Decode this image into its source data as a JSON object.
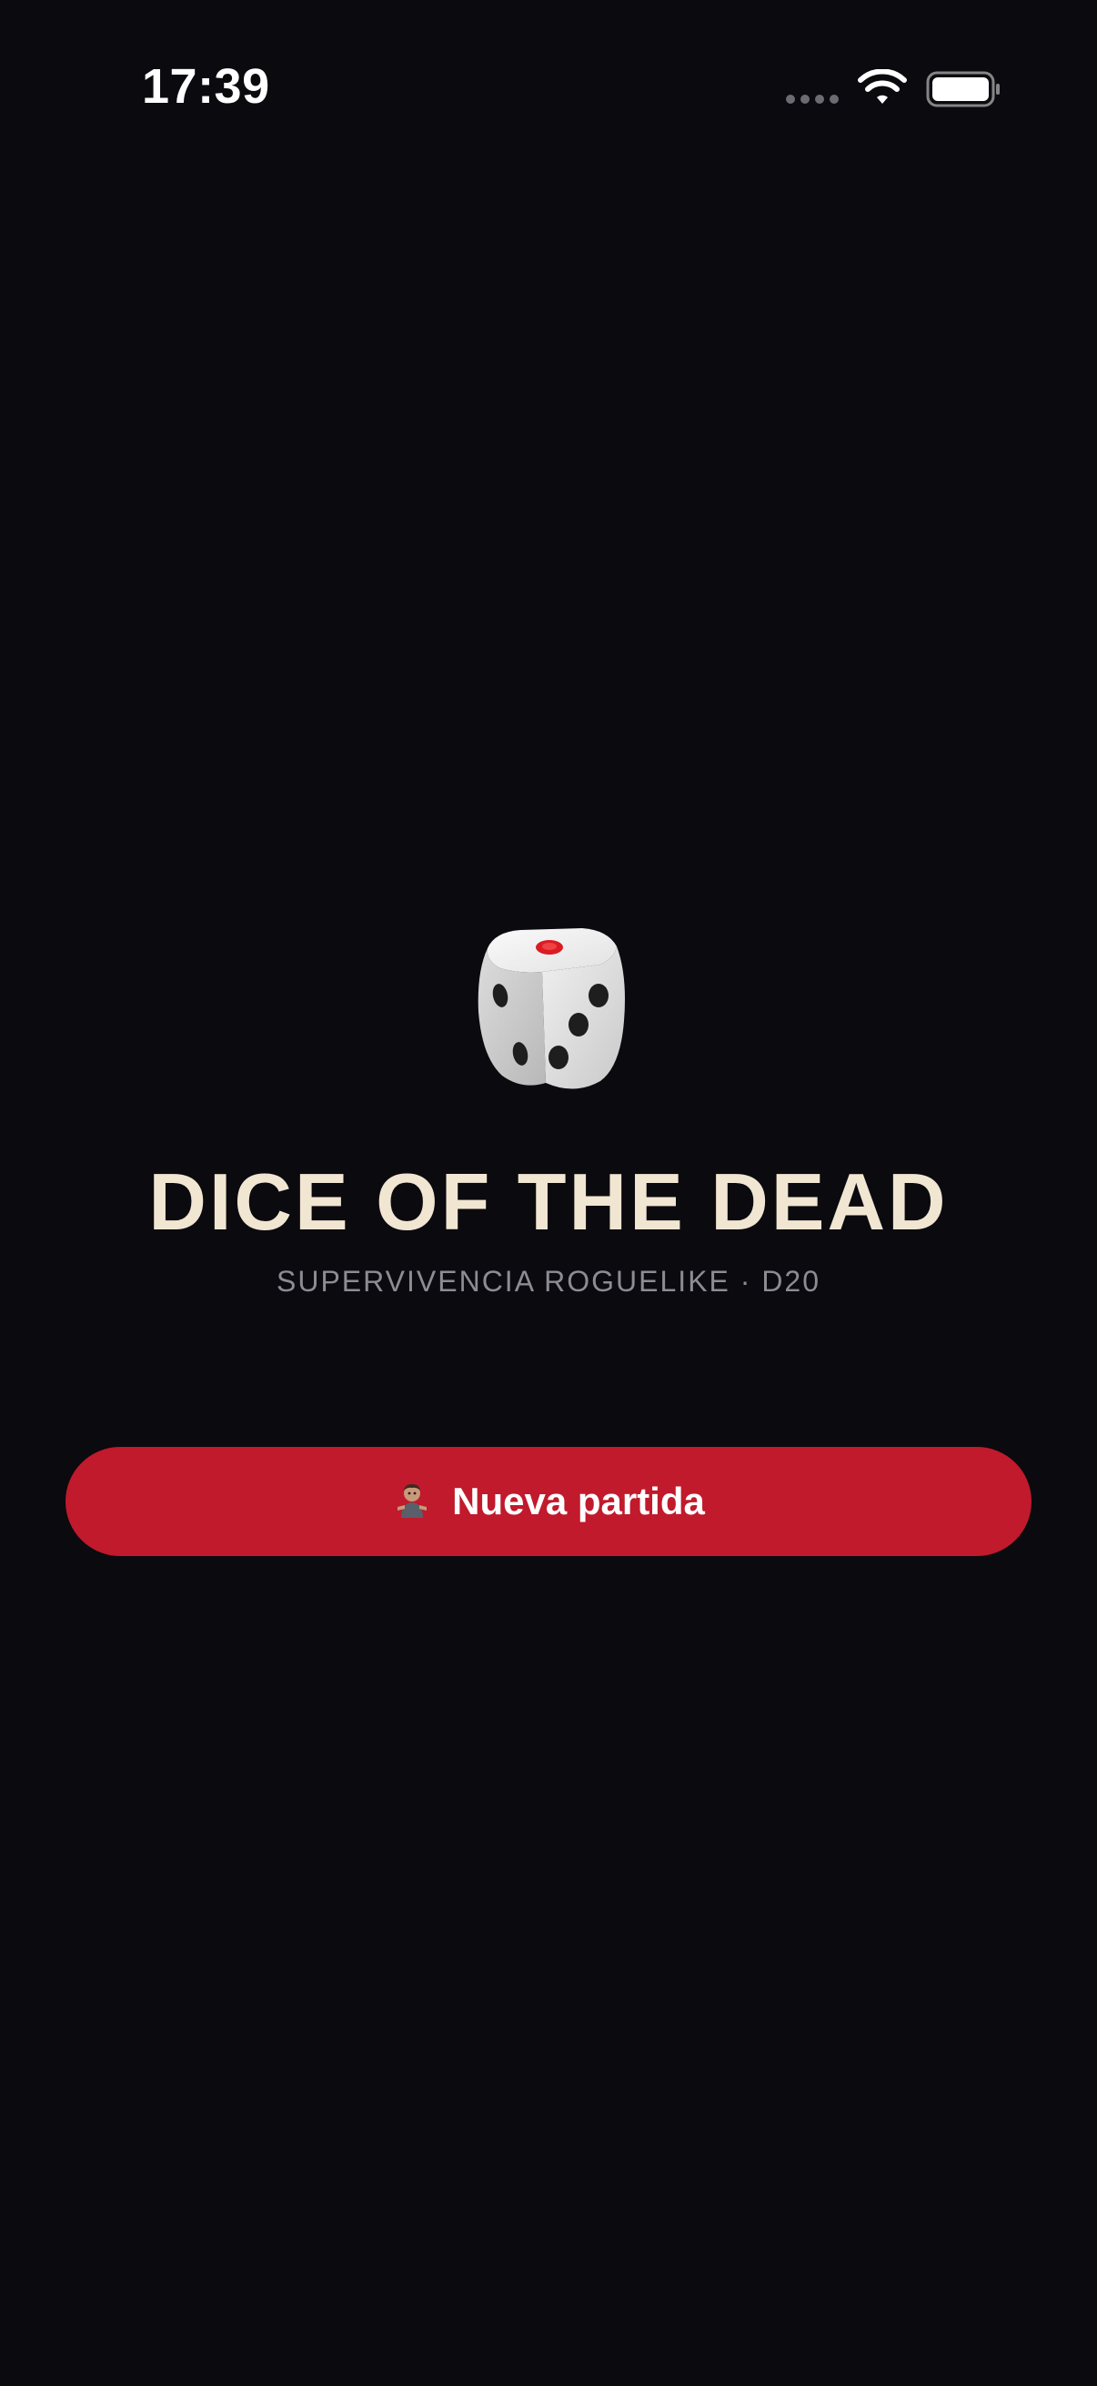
{
  "status_bar": {
    "time": "17:39",
    "icons": [
      "signal-dots-icon",
      "wifi-icon",
      "battery-icon"
    ]
  },
  "hero": {
    "icon": "dice-icon",
    "title": "DICE OF THE DEAD",
    "subtitle": "SUPERVIVENCIA ROGUELIKE · D20"
  },
  "actions": {
    "new_game_icon": "zombie-icon",
    "new_game_label": "Nueva partida"
  },
  "colors": {
    "background": "#0b0a0f",
    "title": "#f1e6d2",
    "subtitle": "#8d8c93",
    "accent": "#c01a2c"
  }
}
